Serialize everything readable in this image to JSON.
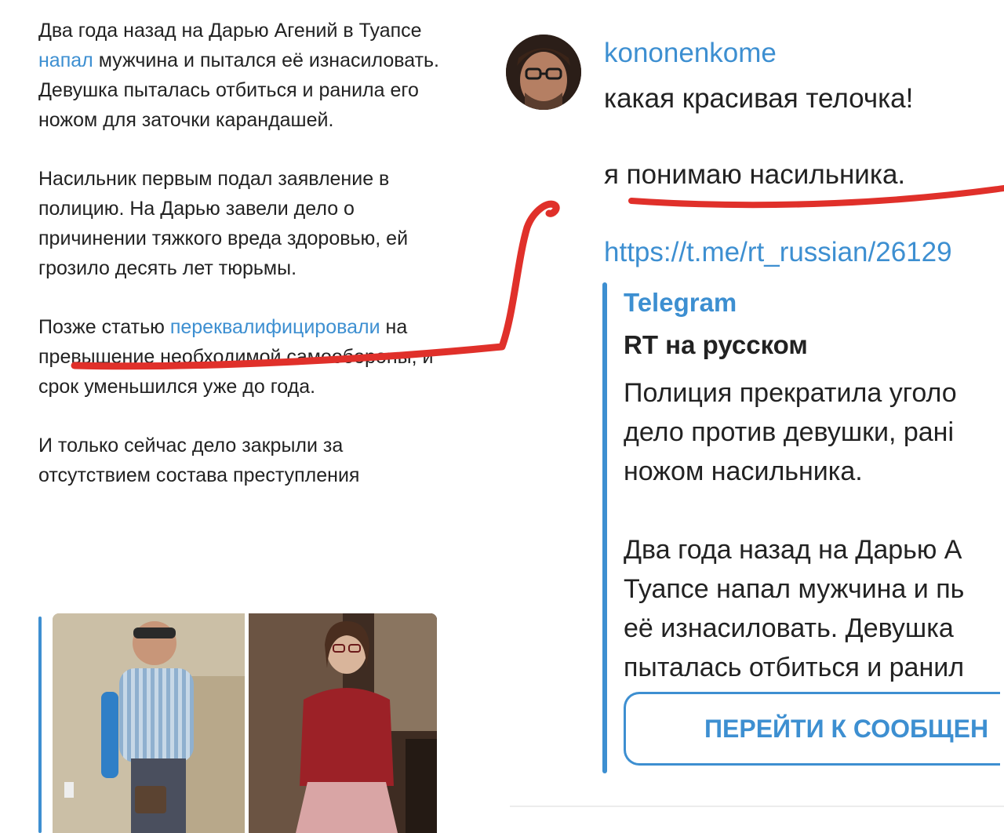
{
  "left_post": {
    "p1_a": "Два года назад на Дарью Агений в Туапсе ",
    "p1_link": "напал",
    "p1_b": " мужчина и пытался её изнасиловать. Девушка пыталась отбиться и ранила его ножом для заточки карандашей.",
    "p2": "Насильник первым подал заявление в полицию. На Дарью завели дело о причинении тяжкого вреда здоровью, ей грозило десять лет тюрьмы.",
    "p3_a": "Позже статью ",
    "p3_link": "переквалифицировали",
    "p3_b": " на превышение необходимой самообороны, и срок уменьшился уже до года.",
    "p4": "И только сейчас дело закрыли за отсутствием состава преступления"
  },
  "comment": {
    "username": "kononenkome",
    "line1": "какая красивая телочка!",
    "line2": "я понимаю насильника.",
    "url": "https://t.me/rt_russian/26129",
    "embed": {
      "site": "Telegram",
      "title": "RT на русском",
      "desc_lines": [
        "Полиция прекратила уголо",
        "дело против девушки, рані",
        "ножом насильника.",
        "Два года назад на Дарью А",
        "Туапсе напал мужчина и пь",
        "её изнасиловать. Девушка",
        "пыталась отбиться и ранил"
      ]
    },
    "button_label": "ПЕРЕЙТИ К СООБЩЕН"
  },
  "colors": {
    "link": "#3d8fd1",
    "annotation": "#e0302a",
    "text": "#222222"
  }
}
